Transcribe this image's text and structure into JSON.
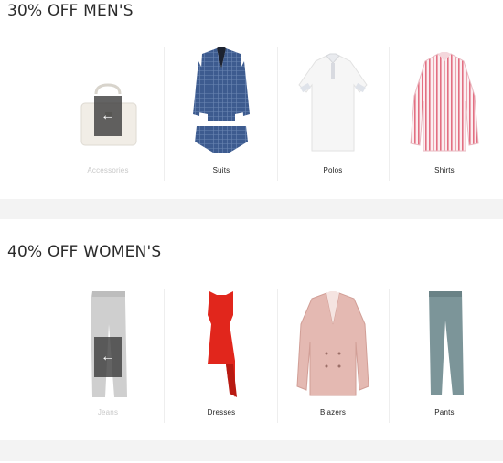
{
  "men": {
    "title": "30% OFF MEN'S",
    "items": [
      {
        "label": "Accessories"
      },
      {
        "label": "Suits"
      },
      {
        "label": "Polos"
      },
      {
        "label": "Shirts"
      }
    ],
    "prev_arrow": "←"
  },
  "women": {
    "title": "40% OFF WOMEN'S",
    "items": [
      {
        "label": "Jeans"
      },
      {
        "label": "Dresses"
      },
      {
        "label": "Blazers"
      },
      {
        "label": "Pants"
      }
    ],
    "prev_arrow": "←"
  },
  "colors": {
    "page_bg": "#f3f3f3",
    "suit_blue": "#3b5a8c",
    "polo_white": "#f4f4f4",
    "shirt_stripe": "#e57a8a",
    "dress_red": "#e0281f",
    "blazer_pink": "#e3b7b0",
    "pants_grey": "#7d9598",
    "jeans_grey": "#cccccc"
  }
}
